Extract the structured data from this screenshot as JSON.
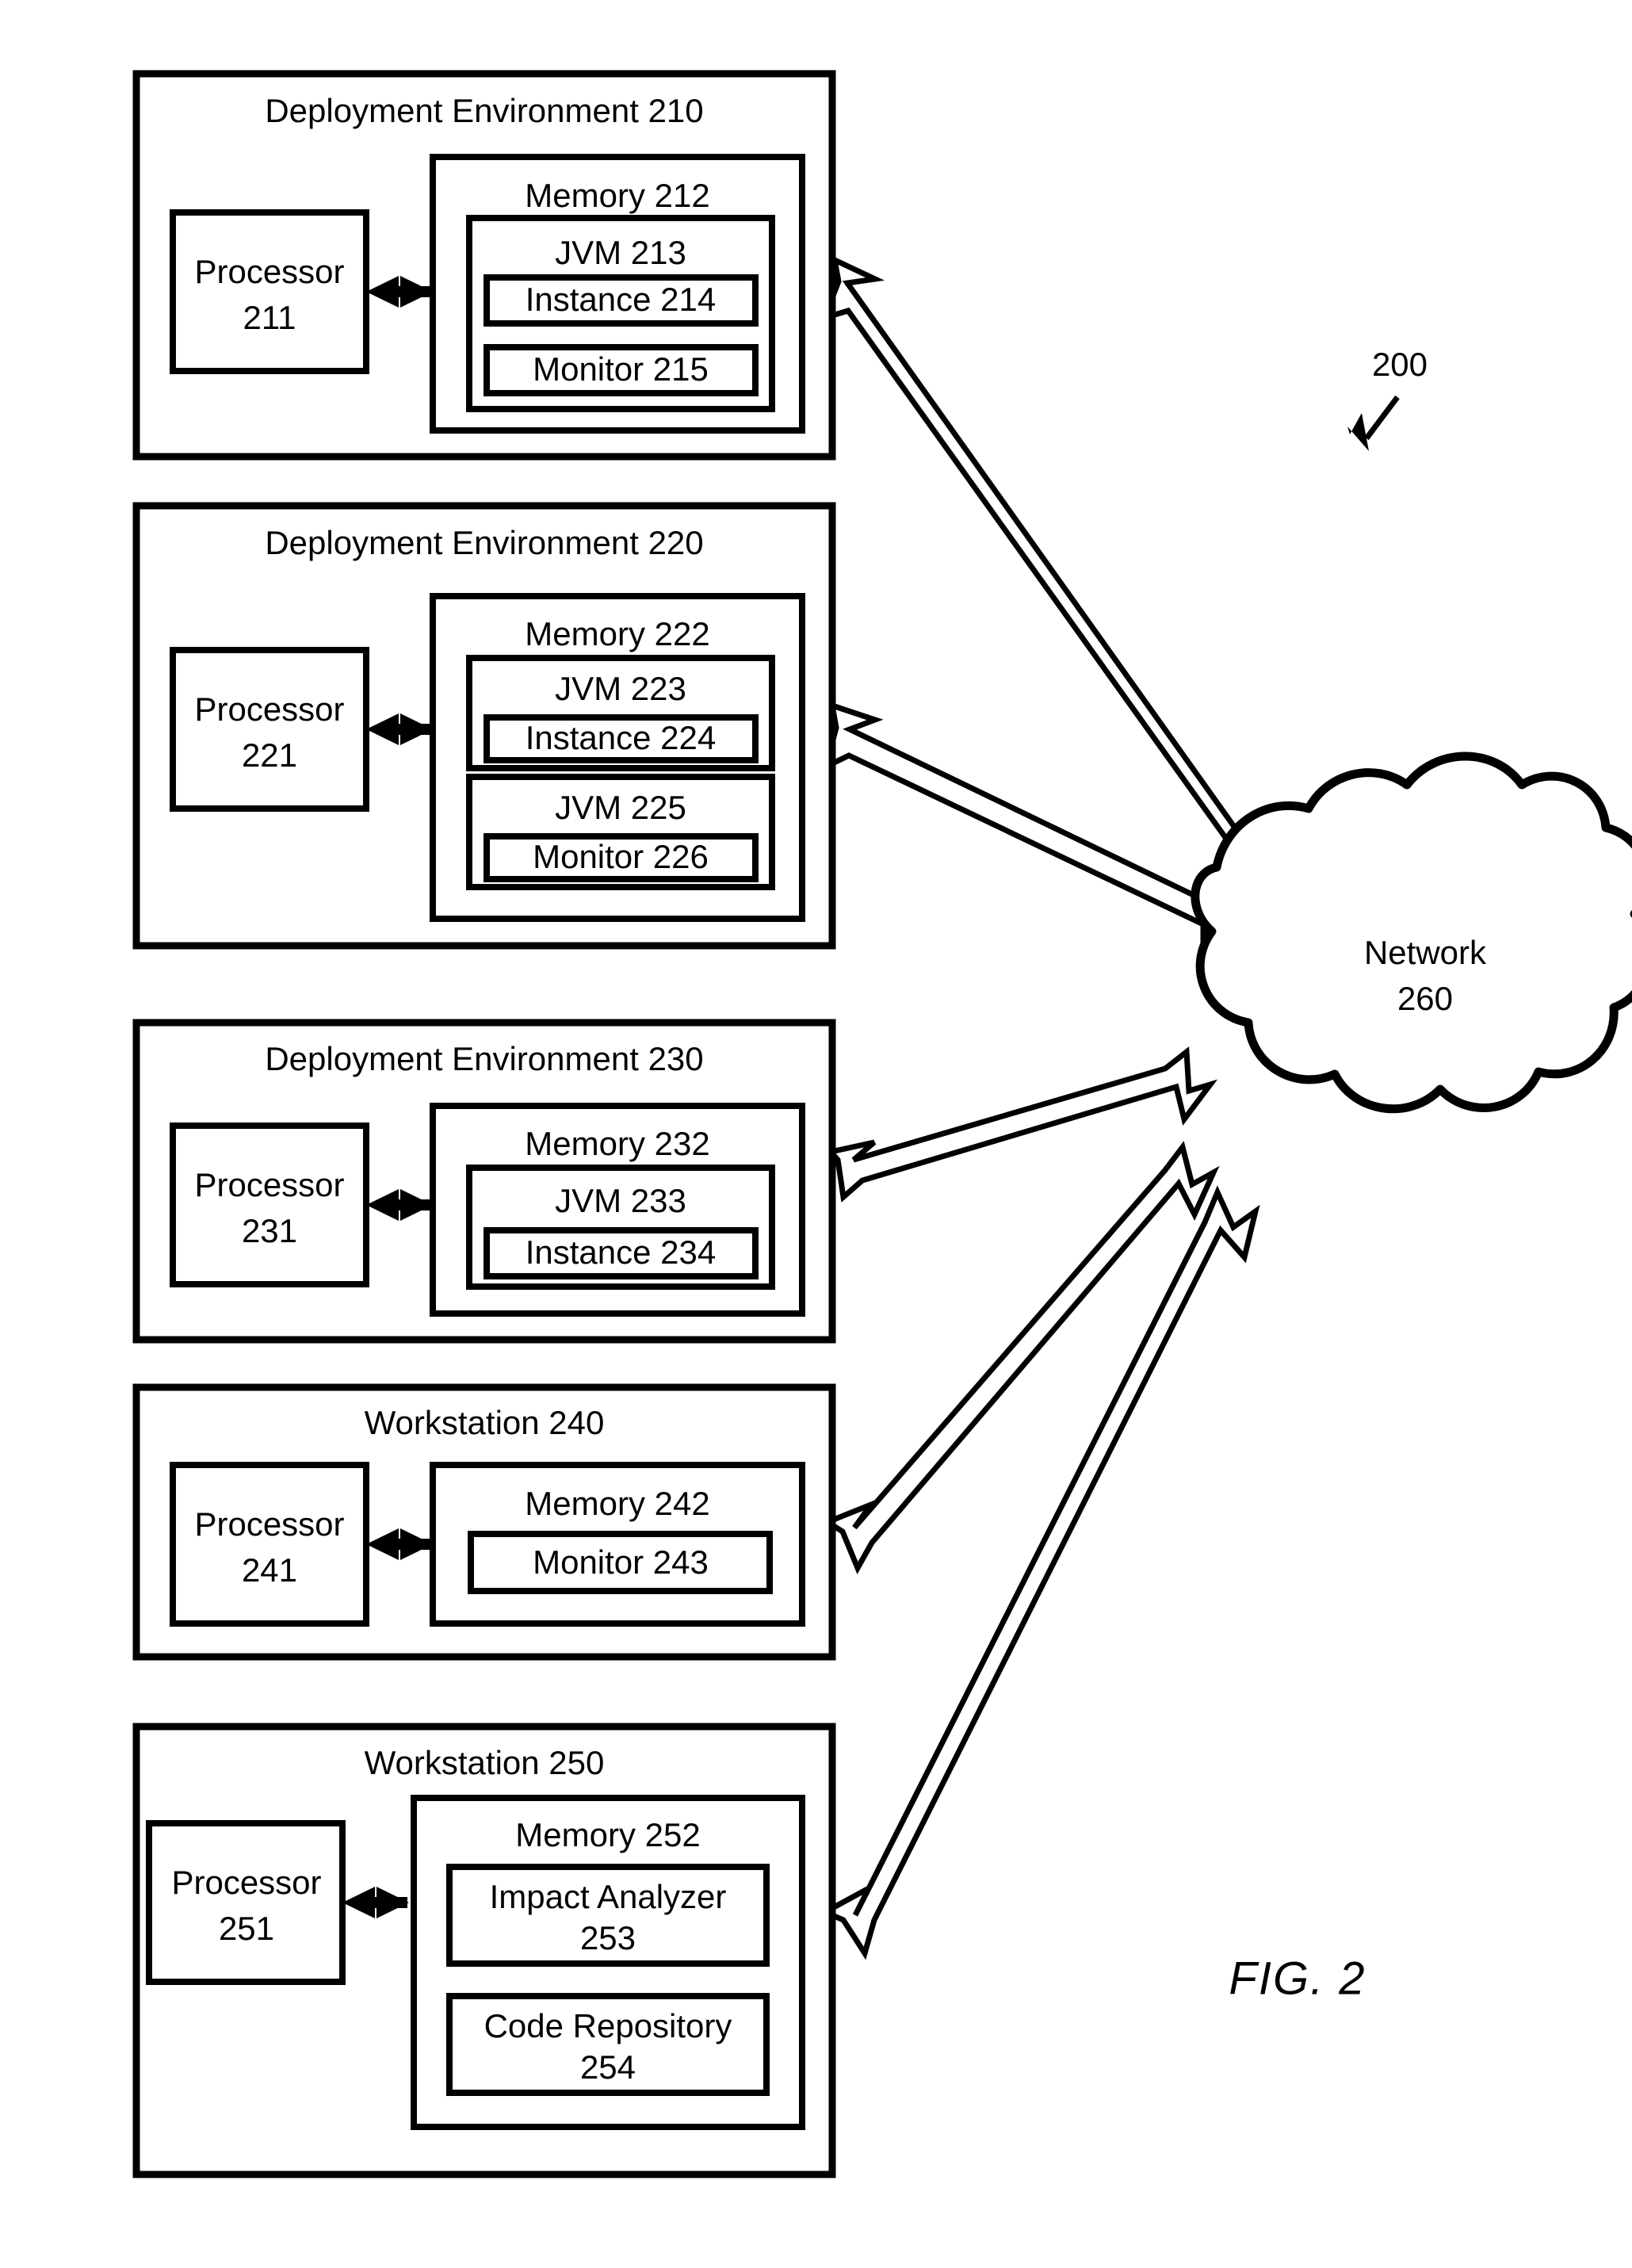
{
  "figure": {
    "label": "FIG. 2",
    "system_ref": "200"
  },
  "network": {
    "name": "Network",
    "ref": "260",
    "line1": "Network",
    "line2": "260"
  },
  "nodes": [
    {
      "id": "de210",
      "title": "Deployment Environment 210",
      "processor": {
        "line1": "Processor",
        "line2": "211"
      },
      "memory": {
        "title": "Memory 212",
        "children": [
          {
            "title": "JVM 213",
            "children": [
              {
                "title": "Instance 214"
              },
              {
                "title": "Monitor 215"
              }
            ]
          }
        ]
      }
    },
    {
      "id": "de220",
      "title": "Deployment Environment 220",
      "processor": {
        "line1": "Processor",
        "line2": "221"
      },
      "memory": {
        "title": "Memory 222",
        "children": [
          {
            "title": "JVM 223",
            "children": [
              {
                "title": "Instance 224"
              }
            ]
          },
          {
            "title": "JVM 225",
            "children": [
              {
                "title": "Monitor 226"
              }
            ]
          }
        ]
      }
    },
    {
      "id": "de230",
      "title": "Deployment Environment 230",
      "processor": {
        "line1": "Processor",
        "line2": "231"
      },
      "memory": {
        "title": "Memory 232",
        "children": [
          {
            "title": "JVM 233",
            "children": [
              {
                "title": "Instance 234"
              }
            ]
          }
        ]
      }
    },
    {
      "id": "ws240",
      "title": "Workstation 240",
      "processor": {
        "line1": "Processor",
        "line2": "241"
      },
      "memory": {
        "title": "Memory 242",
        "children": [
          {
            "title": "Monitor 243"
          }
        ]
      }
    },
    {
      "id": "ws250",
      "title": "Workstation 250",
      "processor": {
        "line1": "Processor",
        "line2": "251"
      },
      "memory": {
        "title": "Memory 252",
        "children": [
          {
            "line1": "Impact Analyzer",
            "line2": "253"
          },
          {
            "line1": "Code Repository",
            "line2": "254"
          }
        ]
      }
    }
  ],
  "connections": [
    {
      "from": "de210",
      "to": "network",
      "bidirectional": true
    },
    {
      "from": "de220",
      "to": "network",
      "bidirectional": true
    },
    {
      "from": "de230",
      "to": "network",
      "bidirectional": true
    },
    {
      "from": "ws240",
      "to": "network",
      "bidirectional": true
    },
    {
      "from": "ws250",
      "to": "network",
      "bidirectional": true
    }
  ]
}
